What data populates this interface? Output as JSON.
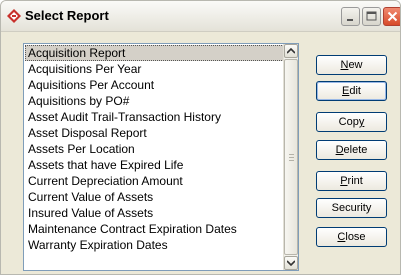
{
  "window": {
    "title": "Select Report"
  },
  "report_list": {
    "selected_index": 0,
    "items": [
      "Acquisition Report",
      "Acquisitions Per Year",
      "Aquisitions Per Account",
      "Aquisitions by PO#",
      "Asset Audit Trail-Transaction History",
      "Asset Disposal Report",
      "Assets Per Location",
      "Assets that have Expired Life",
      "Current Depreciation Amount",
      "Current Value of Assets",
      "Insured Value of Assets",
      "Maintenance Contract Expiration Dates",
      "Warranty Expiration Dates"
    ]
  },
  "buttons": {
    "new": {
      "pre": "",
      "key": "N",
      "post": "ew"
    },
    "edit": {
      "pre": "",
      "key": "E",
      "post": "dit"
    },
    "copy": {
      "pre": "Cop",
      "key": "y",
      "post": ""
    },
    "delete": {
      "pre": "",
      "key": "D",
      "post": "elete"
    },
    "print": {
      "pre": "",
      "key": "P",
      "post": "rint"
    },
    "security": {
      "label": "Security"
    },
    "close": {
      "pre": "",
      "key": "C",
      "post": "lose"
    }
  },
  "icons": {
    "app": "report-diamond-icon",
    "minimize": "minimize-icon",
    "maximize": "maximize-icon",
    "close": "close-icon",
    "scroll_up": "chevron-up-icon",
    "scroll_down": "chevron-down-icon"
  },
  "colors": {
    "window_bg": "#ece9d8",
    "selection_bg": "#d4d0c8",
    "button_border": "#003c74",
    "close_button": "#d74a2a",
    "app_icon": "#c8302c"
  }
}
